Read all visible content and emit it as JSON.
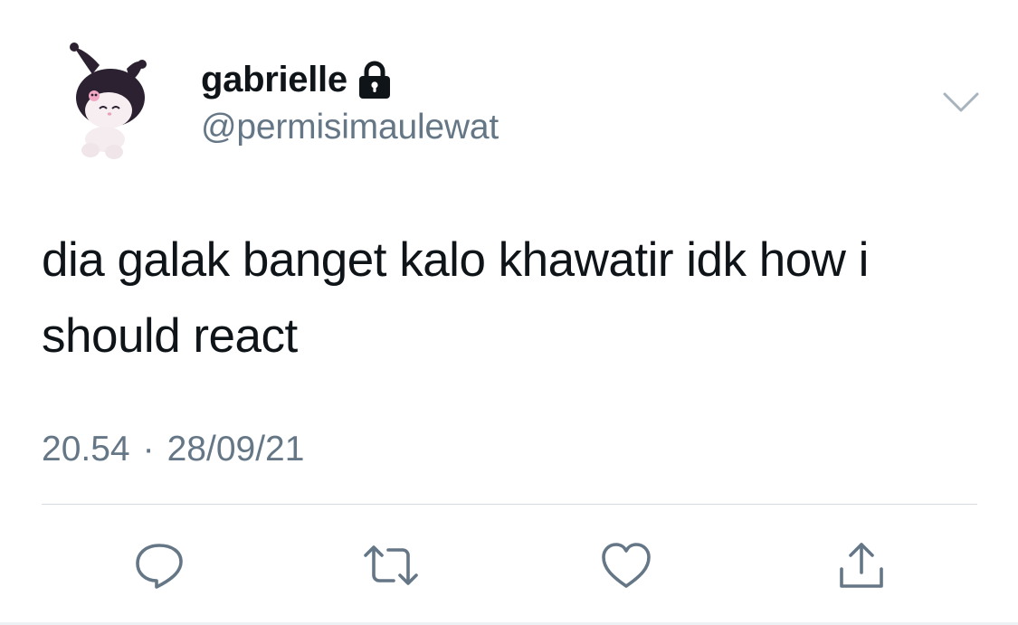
{
  "tweet": {
    "display_name": "gabrielle",
    "handle": "@permisimaulewat",
    "text": "dia galak banget kalo khawatir idk how i should react",
    "time": "20.54",
    "separator": "·",
    "date": "28/09/21",
    "protected": true
  },
  "icons": {
    "avatar": "kuromi-avatar",
    "lock": "lock-icon",
    "more": "chevron-down-icon",
    "reply": "reply-icon",
    "retweet": "retweet-icon",
    "like": "heart-icon",
    "share": "share-icon"
  },
  "colors": {
    "text": "#0f1419",
    "secondary": "#657786",
    "divider": "#d5dbe0",
    "icon": "#657786"
  }
}
